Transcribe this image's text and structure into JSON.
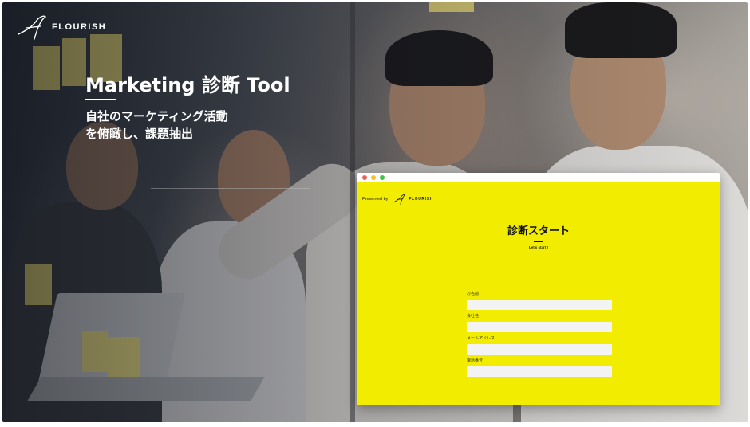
{
  "brand": {
    "name": "FLOURISH",
    "logo_icon": "flourish-script-f-icon"
  },
  "hero": {
    "title": "Marketing 診断 Tool",
    "subtitle_line1": "自社のマーケティング活動",
    "subtitle_line2": "を俯瞰し、課題抽出"
  },
  "window": {
    "controls": [
      "close-dot",
      "minimize-dot",
      "maximize-dot"
    ],
    "presented_by": "Presented by",
    "logo_text": "FLOURISH",
    "form_title": "診断スタート",
    "form_subtitle": "Let's start !",
    "fields": [
      {
        "label": "お名前",
        "value": "",
        "placeholder": ""
      },
      {
        "label": "会社名",
        "value": "",
        "placeholder": ""
      },
      {
        "label": "メールアドレス",
        "value": "",
        "placeholder": ""
      },
      {
        "label": "電話番号",
        "value": "",
        "placeholder": ""
      }
    ]
  },
  "colors": {
    "accent_yellow": "#f1ec00",
    "text_white": "#ffffff",
    "dot_red": "#f25e56",
    "dot_yellow": "#f7bd2e",
    "dot_green": "#3ec63f"
  }
}
